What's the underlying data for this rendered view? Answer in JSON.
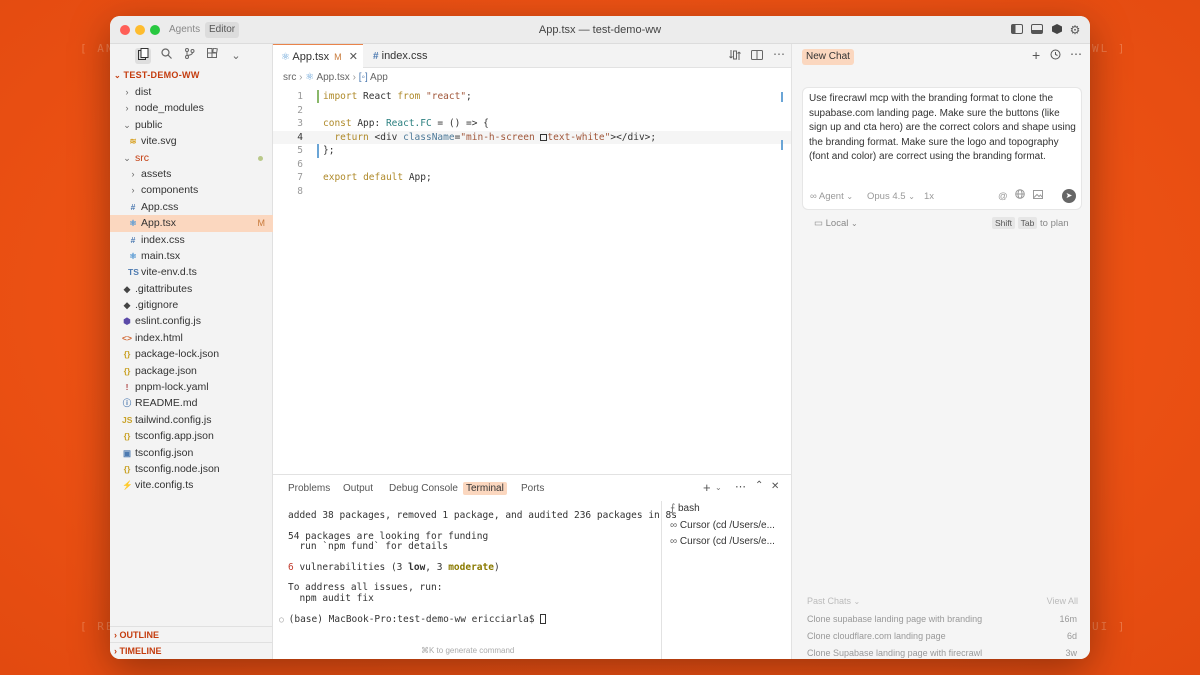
{
  "background_labels": {
    "top_left": "[ AN",
    "top_right": "WL ]",
    "bottom_left": "[ RE",
    "bottom_right": "UI ]"
  },
  "window": {
    "title": "App.tsx — test-demo-ww",
    "mode_tabs": [
      "Agents",
      "Editor"
    ],
    "active_mode": "Editor"
  },
  "sidebar": {
    "project": "TEST-DEMO-WW",
    "tree": [
      {
        "indent": 0,
        "type": "folder",
        "open": false,
        "name": "dist"
      },
      {
        "indent": 0,
        "type": "folder",
        "open": false,
        "name": "node_modules"
      },
      {
        "indent": 0,
        "type": "folder",
        "open": true,
        "name": "public"
      },
      {
        "indent": 1,
        "type": "file",
        "name": "vite.svg",
        "icon": "svg-file-icon"
      },
      {
        "indent": 0,
        "type": "folder",
        "open": true,
        "name": "src",
        "dot": true,
        "accent": true
      },
      {
        "indent": 1,
        "type": "folder",
        "open": false,
        "name": "assets"
      },
      {
        "indent": 1,
        "type": "folder",
        "open": false,
        "name": "components"
      },
      {
        "indent": 1,
        "type": "file",
        "name": "App.css",
        "icon": "css-file-icon"
      },
      {
        "indent": 1,
        "type": "file",
        "name": "App.tsx",
        "icon": "react-file-icon",
        "selected": true,
        "badge": "M"
      },
      {
        "indent": 1,
        "type": "file",
        "name": "index.css",
        "icon": "css-file-icon"
      },
      {
        "indent": 1,
        "type": "file",
        "name": "main.tsx",
        "icon": "react-file-icon"
      },
      {
        "indent": 1,
        "type": "file",
        "name": "vite-env.d.ts",
        "icon": "ts-file-icon"
      },
      {
        "indent": 0,
        "type": "file",
        "name": ".gitattributes",
        "icon": "git-file-icon"
      },
      {
        "indent": 0,
        "type": "file",
        "name": ".gitignore",
        "icon": "git-file-icon"
      },
      {
        "indent": 0,
        "type": "file",
        "name": "eslint.config.js",
        "icon": "eslint-file-icon"
      },
      {
        "indent": 0,
        "type": "file",
        "name": "index.html",
        "icon": "html-file-icon"
      },
      {
        "indent": 0,
        "type": "file",
        "name": "package-lock.json",
        "icon": "json-file-icon"
      },
      {
        "indent": 0,
        "type": "file",
        "name": "package.json",
        "icon": "json-file-icon"
      },
      {
        "indent": 0,
        "type": "file",
        "name": "pnpm-lock.yaml",
        "icon": "yaml-file-icon"
      },
      {
        "indent": 0,
        "type": "file",
        "name": "README.md",
        "icon": "info-file-icon"
      },
      {
        "indent": 0,
        "type": "file",
        "name": "tailwind.config.js",
        "icon": "js-file-icon"
      },
      {
        "indent": 0,
        "type": "file",
        "name": "tsconfig.app.json",
        "icon": "json-file-icon"
      },
      {
        "indent": 0,
        "type": "file",
        "name": "tsconfig.json",
        "icon": "tsconfig-file-icon"
      },
      {
        "indent": 0,
        "type": "file",
        "name": "tsconfig.node.json",
        "icon": "json-file-icon"
      },
      {
        "indent": 0,
        "type": "file",
        "name": "vite.config.ts",
        "icon": "vite-file-icon"
      }
    ],
    "outline_label": "OUTLINE",
    "timeline_label": "TIMELINE"
  },
  "editor": {
    "tabs": [
      {
        "name": "App.tsx",
        "modified": "M",
        "active": true
      },
      {
        "name": "index.css",
        "active": false
      }
    ],
    "breadcrumb": [
      "src",
      "App.tsx",
      "App"
    ]
  },
  "panel": {
    "tabs": [
      "Problems",
      "Output",
      "Debug Console",
      "Terminal",
      "Ports"
    ],
    "active_tab": "Terminal",
    "terminal_lines": {
      "l1": "added 38 packages, removed 1 package, and audited 236 packages in 8s",
      "l2": "54 packages are looking for funding",
      "l3": "  run `npm fund` for details",
      "l4_count": "6",
      "l4_a": " vulnerabilities (3 ",
      "l4_low": "low",
      "l4_b": ", 3 ",
      "l4_mod": "moderate",
      "l4_c": ")",
      "l5": "To address all issues, run:",
      "l6": "  npm audit fix",
      "prompt": "(base) MacBook-Pro:test-demo-ww ericciarla$ "
    },
    "sessions": [
      "bash",
      "Cursor (cd /Users/e...",
      "Cursor (cd /Users/e..."
    ],
    "hint": "⌘K to generate command"
  },
  "chat": {
    "new_chat_label": "New Chat",
    "prompt": "Use firecrawl mcp with the branding format to clone the supabase.com landing page. Make sure the buttons (like sign up and cta hero) are the correct colors and shape using the branding format. Make sure the logo and topography (font and color) are correct using the branding format.",
    "agent_label": "Agent",
    "model_label": "Opus 4.5",
    "multiplier": "1x",
    "location_label": "Local",
    "shortcut_shift": "Shift",
    "shortcut_tab": "Tab",
    "shortcut_suffix": "to plan",
    "past_chats_label": "Past Chats",
    "view_all_label": "View All",
    "past_chats": [
      {
        "title": "Clone supabase landing page with branding",
        "time": "16m"
      },
      {
        "title": "Clone cloudflare.com landing page",
        "time": "6d"
      },
      {
        "title": "Clone Supabase landing page with firecrawl",
        "time": "3w"
      }
    ]
  }
}
